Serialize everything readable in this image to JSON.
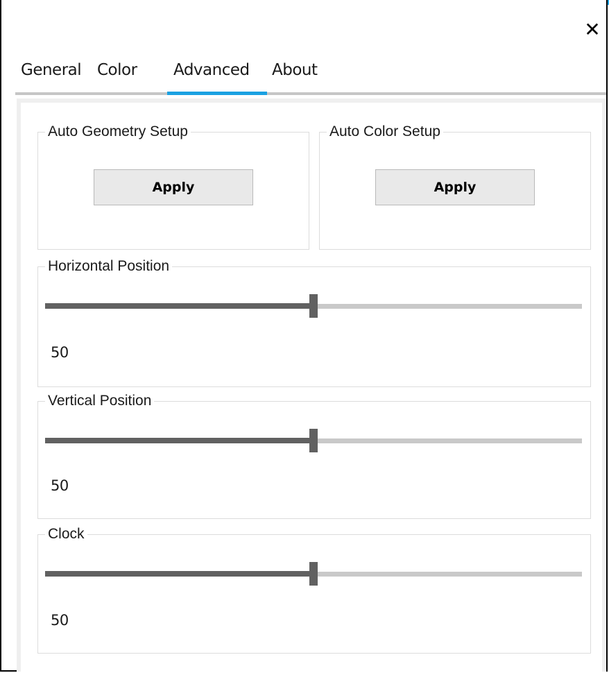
{
  "window": {
    "accent_color": "#1ba1e2",
    "close_icon": "close-icon"
  },
  "tabs": [
    {
      "label": "General",
      "active": false
    },
    {
      "label": "Color",
      "active": false
    },
    {
      "label": "Advanced",
      "active": true
    },
    {
      "label": "About",
      "active": false
    }
  ],
  "auto_geometry": {
    "title": "Auto Geometry Setup",
    "button": "Apply"
  },
  "auto_color": {
    "title": "Auto Color Setup",
    "button": "Apply"
  },
  "sliders": [
    {
      "title": "Horizontal Position",
      "value": "50",
      "fraction": 0.5
    },
    {
      "title": "Vertical Position",
      "value": "50",
      "fraction": 0.5
    },
    {
      "title": "Clock",
      "value": "50",
      "fraction": 0.5
    }
  ]
}
